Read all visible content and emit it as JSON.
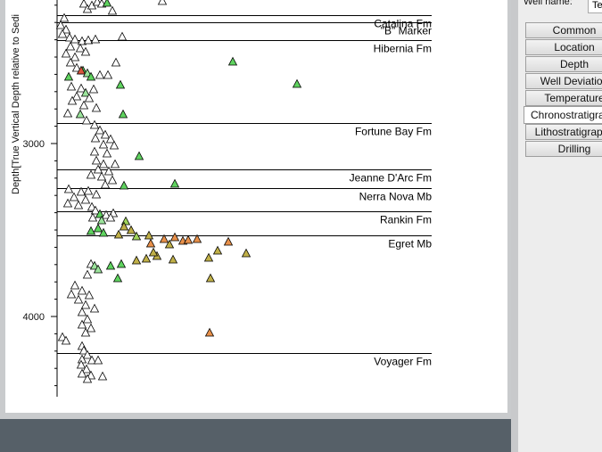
{
  "plot": {
    "y_axis_label": "Depth[True Vertical Depth relative to Sedi",
    "y_ticks": [
      "3000",
      "4000"
    ],
    "formations": [
      {
        "name": "Catalina Fm",
        "depth": 2260
      },
      {
        "name": "\"B\" Marker",
        "depth": 2300
      },
      {
        "name": "Hibernia Fm",
        "depth": 2400
      },
      {
        "name": "Fortune Bay Fm",
        "depth": 2880
      },
      {
        "name": "Jeanne D'Arc Fm",
        "depth": 3150
      },
      {
        "name": "Nerra Nova Mb",
        "depth": 3260
      },
      {
        "name": "Rankin Fm",
        "depth": 3390
      },
      {
        "name": "Egret Mb",
        "depth": 3530
      },
      {
        "name": "Voyager Fm",
        "depth": 4210
      }
    ],
    "colors": {
      "white": "#ffffff",
      "green_light": "#9be39b",
      "green": "#5fd35f",
      "yellow_green": "#9fd35a",
      "olive": "#c0b048",
      "orange": "#e8904a",
      "red": "#d9553d"
    }
  },
  "sidebar": {
    "well_name_label": "Well name:",
    "well_name_value": "Te",
    "tabs": [
      {
        "label": "Common",
        "active": false
      },
      {
        "label": "Location",
        "active": false
      },
      {
        "label": "Depth",
        "active": false
      },
      {
        "label": "Well Deviation",
        "active": false
      },
      {
        "label": "Temperature",
        "active": false
      },
      {
        "label": "Chronostratigraphy",
        "active": true
      },
      {
        "label": "Lithostratigraphy",
        "active": false
      },
      {
        "label": "Drilling",
        "active": false
      }
    ]
  }
}
